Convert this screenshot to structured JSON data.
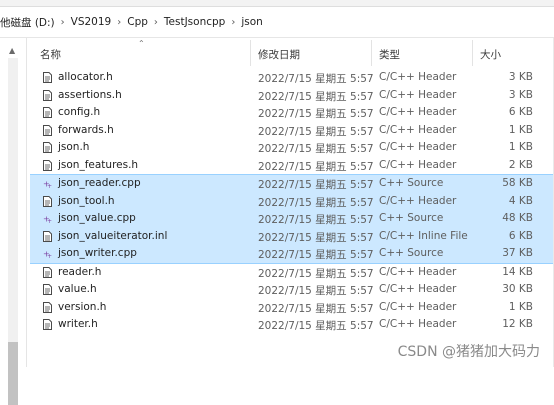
{
  "breadcrumb": [
    {
      "label": "他磁盘 (D:)"
    },
    {
      "label": "VS2019"
    },
    {
      "label": "Cpp"
    },
    {
      "label": "TestJsoncpp"
    },
    {
      "label": "json"
    }
  ],
  "columns": {
    "name": "名称",
    "date": "修改日期",
    "type": "类型",
    "size": "大小"
  },
  "files": [
    {
      "name": "allocator.h",
      "date": "2022/7/15 星期五 5:57",
      "type": "C/C++ Header",
      "size": "3 KB",
      "icon": "header-file-icon",
      "selected": false
    },
    {
      "name": "assertions.h",
      "date": "2022/7/15 星期五 5:57",
      "type": "C/C++ Header",
      "size": "3 KB",
      "icon": "header-file-icon",
      "selected": false
    },
    {
      "name": "config.h",
      "date": "2022/7/15 星期五 5:57",
      "type": "C/C++ Header",
      "size": "6 KB",
      "icon": "header-file-icon",
      "selected": false
    },
    {
      "name": "forwards.h",
      "date": "2022/7/15 星期五 5:57",
      "type": "C/C++ Header",
      "size": "1 KB",
      "icon": "header-file-icon",
      "selected": false
    },
    {
      "name": "json.h",
      "date": "2022/7/15 星期五 5:57",
      "type": "C/C++ Header",
      "size": "1 KB",
      "icon": "header-file-icon",
      "selected": false
    },
    {
      "name": "json_features.h",
      "date": "2022/7/15 星期五 5:57",
      "type": "C/C++ Header",
      "size": "2 KB",
      "icon": "header-file-icon",
      "selected": false
    },
    {
      "name": "json_reader.cpp",
      "date": "2022/7/15 星期五 5:57",
      "type": "C++ Source",
      "size": "58 KB",
      "icon": "cpp-file-icon",
      "selected": true
    },
    {
      "name": "json_tool.h",
      "date": "2022/7/15 星期五 5:57",
      "type": "C/C++ Header",
      "size": "4 KB",
      "icon": "header-file-icon",
      "selected": true
    },
    {
      "name": "json_value.cpp",
      "date": "2022/7/15 星期五 5:57",
      "type": "C++ Source",
      "size": "48 KB",
      "icon": "cpp-file-icon",
      "selected": true
    },
    {
      "name": "json_valueiterator.inl",
      "date": "2022/7/15 星期五 5:57",
      "type": "C/C++ Inline File",
      "size": "6 KB",
      "icon": "inline-file-icon",
      "selected": true
    },
    {
      "name": "json_writer.cpp",
      "date": "2022/7/15 星期五 5:57",
      "type": "C++ Source",
      "size": "37 KB",
      "icon": "cpp-file-icon",
      "selected": true
    },
    {
      "name": "reader.h",
      "date": "2022/7/15 星期五 5:57",
      "type": "C/C++ Header",
      "size": "14 KB",
      "icon": "header-file-icon",
      "selected": false
    },
    {
      "name": "value.h",
      "date": "2022/7/15 星期五 5:57",
      "type": "C/C++ Header",
      "size": "30 KB",
      "icon": "header-file-icon",
      "selected": false
    },
    {
      "name": "version.h",
      "date": "2022/7/15 星期五 5:57",
      "type": "C/C++ Header",
      "size": "1 KB",
      "icon": "header-file-icon",
      "selected": false
    },
    {
      "name": "writer.h",
      "date": "2022/7/15 星期五 5:57",
      "type": "C/C++ Header",
      "size": "12 KB",
      "icon": "header-file-icon",
      "selected": false
    }
  ],
  "watermark": "CSDN @猪猪加大码力",
  "colors": {
    "selection": "#cce8ff",
    "selection_border": "#99d1ff",
    "cpp_icon": "#7b3fa0"
  }
}
